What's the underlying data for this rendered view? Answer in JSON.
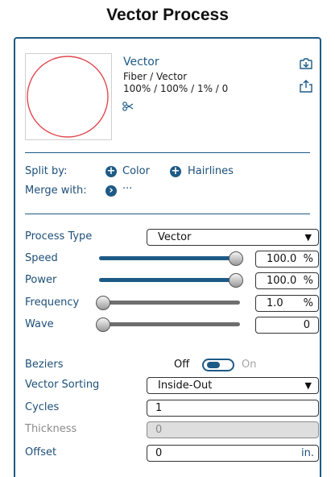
{
  "page": {
    "title": "Vector Process"
  },
  "layer": {
    "name": "Vector",
    "type_line": "Fiber / Vector",
    "stats_line": "100% / 100% / 1% / 0",
    "thumbnail_icon": "red-circle",
    "thumbnail_color": "#e2474f"
  },
  "icons": {
    "scissors": "scissors-icon",
    "import": "import-icon",
    "export": "export-icon"
  },
  "split": {
    "label": "Split by:",
    "color_label": "Color",
    "hairlines_label": "Hairlines"
  },
  "merge": {
    "label": "Merge with:",
    "more_label": "···"
  },
  "process_type": {
    "label": "Process Type",
    "value": "Vector"
  },
  "speed": {
    "label": "Speed",
    "value": "100.0",
    "unit": "%",
    "level": 1.0
  },
  "power": {
    "label": "Power",
    "value": "100.0",
    "unit": "%",
    "level": 1.0
  },
  "frequency": {
    "label": "Frequency",
    "value": "1.0",
    "unit": "%",
    "level": 0.0
  },
  "wave": {
    "label": "Wave",
    "value": "0",
    "level": 0.0
  },
  "beziers": {
    "label": "Beziers",
    "off_label": "Off",
    "on_label": "On",
    "state": "off"
  },
  "vector_sorting": {
    "label": "Vector Sorting",
    "value": "Inside-Out"
  },
  "cycles": {
    "label": "Cycles",
    "value": "1"
  },
  "thickness": {
    "label": "Thickness",
    "value": "0"
  },
  "offset": {
    "label": "Offset",
    "value": "0",
    "unit": "in."
  },
  "colors": {
    "accent": "#1d5a86",
    "track_active": "#1d5a86",
    "track_inactive": "#6e6e6e"
  }
}
